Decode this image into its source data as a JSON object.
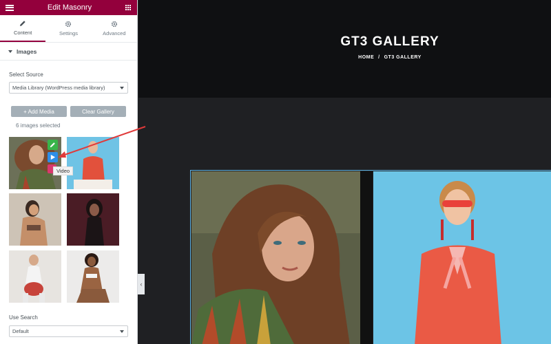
{
  "editor": {
    "title": "Edit Masonry",
    "tabs": [
      {
        "label": "Content",
        "icon": "pencil-icon"
      },
      {
        "label": "Settings",
        "icon": "gear-icon"
      },
      {
        "label": "Advanced",
        "icon": "gear-icon"
      }
    ],
    "section_title": "Images",
    "source_label": "Select Source",
    "source_value": "Media Library (WordPress media library)",
    "add_media_label": "+ Add Media",
    "clear_gallery_label": "Clear Gallery",
    "images_count": "6 images selected",
    "tooltip": "Video",
    "search_label": "Use Search",
    "search_value": "Default"
  },
  "page": {
    "title": "GT3 GALLERY",
    "breadcrumb": [
      "HOME",
      "GT3 GALLERY"
    ],
    "breadcrumb_separator": "/"
  },
  "colors": {
    "brand": "#93003c",
    "edit": "#39b54a",
    "video": "#2e8ee8",
    "delete": "#d9386d",
    "frame": "#60b5e6",
    "arrow": "#e03a3a"
  }
}
